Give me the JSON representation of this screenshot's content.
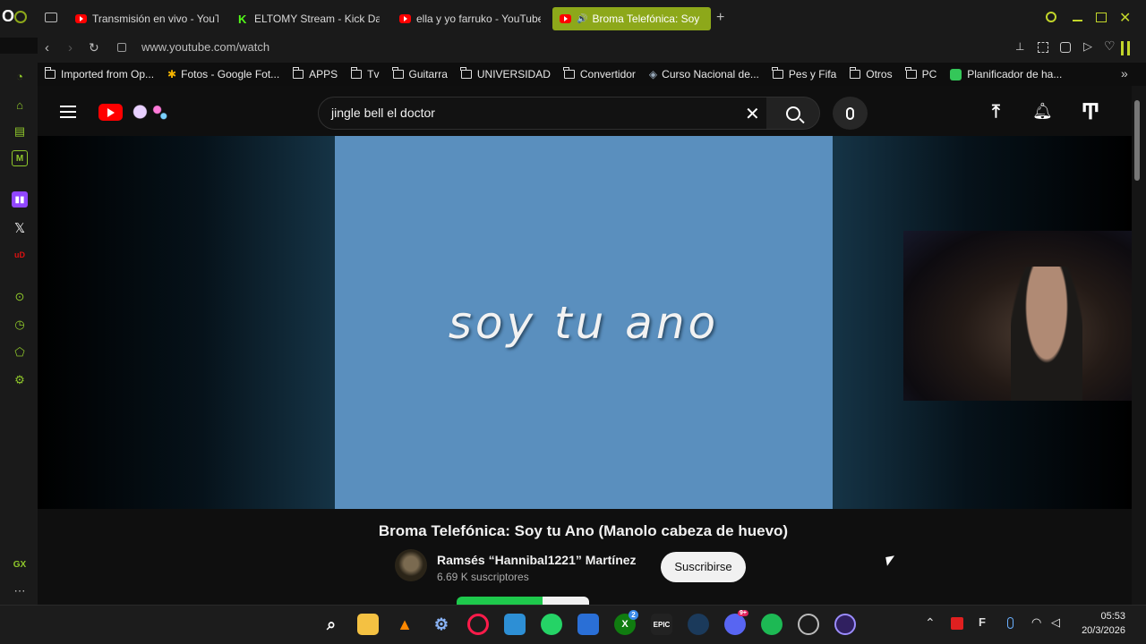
{
  "browser": {
    "tabs": [
      {
        "label": "Transmisión en vivo - YouT",
        "favicon": "youtube-icon"
      },
      {
        "label": "ELTOMY Stream - Kick Da",
        "favicon": "kick-icon"
      },
      {
        "label": "ella y yo farruko - YouTube",
        "favicon": "youtube-icon"
      },
      {
        "label": "Broma Telefónica: Soy",
        "favicon": "youtube-icon",
        "active": true
      }
    ],
    "new_tab": "+",
    "url": "www.youtube.com/watch",
    "bookmarks": [
      {
        "label": "Imported from Op...",
        "icon": "folder-icon"
      },
      {
        "label": "Fotos - Google Fot...",
        "icon": "google-photos-icon"
      },
      {
        "label": "APPS",
        "icon": "folder-icon"
      },
      {
        "label": "Tv",
        "icon": "folder-icon"
      },
      {
        "label": "Guitarra",
        "icon": "folder-icon"
      },
      {
        "label": "UNIVERSIDAD",
        "icon": "folder-icon"
      },
      {
        "label": "Convertidor",
        "icon": "folder-icon"
      },
      {
        "label": "Curso Nacional de...",
        "icon": "site-icon"
      },
      {
        "label": "Pes y Fifa",
        "icon": "folder-icon"
      },
      {
        "label": "Otros",
        "icon": "folder-icon"
      },
      {
        "label": "PC",
        "icon": "folder-icon"
      },
      {
        "label": "Planificador de ha...",
        "icon": "planner-icon"
      }
    ],
    "sidebar_label": "GX",
    "accent": "#8da81a"
  },
  "youtube": {
    "search_query": "jingle bell el doctor",
    "video_overlay_text": "soy tu ano",
    "video_title": "Broma Telefónica: Soy tu Ano (Manolo cabeza de huevo)",
    "channel_name": "Ramsés “Hannibal1221” Martínez",
    "subscribers": "6.69 K suscriptores",
    "subscribe_label": "Suscribirse"
  },
  "taskbar": {
    "time": "05:53",
    "date": "20/3/2026",
    "xbox_badge": "2",
    "discord_badge": "9+",
    "epic_label": "EPIC",
    "f_label": "F"
  }
}
